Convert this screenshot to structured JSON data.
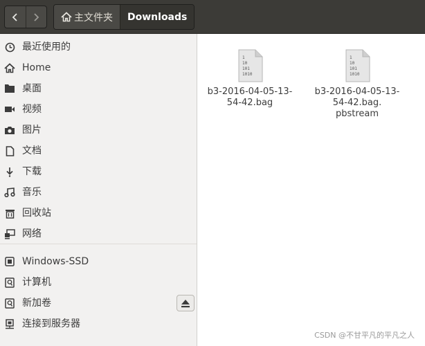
{
  "header": {
    "breadcrumbs": [
      {
        "label": "主文件夹",
        "icon": "home-icon"
      },
      {
        "label": "Downloads"
      }
    ]
  },
  "sidebar": {
    "items": [
      {
        "label": "最近使用的",
        "icon": "clock-icon"
      },
      {
        "label": "Home",
        "icon": "home-icon"
      },
      {
        "label": "桌面",
        "icon": "folder-icon"
      },
      {
        "label": "视频",
        "icon": "video-icon"
      },
      {
        "label": "图片",
        "icon": "camera-icon"
      },
      {
        "label": "文档",
        "icon": "document-icon"
      },
      {
        "label": "下载",
        "icon": "download-icon"
      },
      {
        "label": "音乐",
        "icon": "music-icon"
      },
      {
        "label": "回收站",
        "icon": "trash-icon"
      },
      {
        "label": "网络",
        "icon": "network-icon"
      }
    ],
    "devices": [
      {
        "label": "Windows-SSD",
        "icon": "drive-icon"
      },
      {
        "label": "计算机",
        "icon": "harddisk-icon"
      },
      {
        "label": "新加卷",
        "icon": "harddisk-icon"
      },
      {
        "label": "连接到服务器",
        "icon": "server-icon"
      }
    ]
  },
  "files": [
    {
      "name_lines": [
        "b3-2016-04-05-13-",
        "54-42.bag"
      ],
      "icon": "binary-file-icon",
      "icon_text": [
        "1",
        "10",
        "101",
        "1010"
      ]
    },
    {
      "name_lines": [
        "b3-2016-04-05-13-",
        "54-42.bag.",
        "pbstream"
      ],
      "icon": "binary-file-icon",
      "icon_text": [
        "1",
        "10",
        "101",
        "1010"
      ]
    }
  ],
  "watermark": "CSDN @不甘平凡的平凡之人"
}
